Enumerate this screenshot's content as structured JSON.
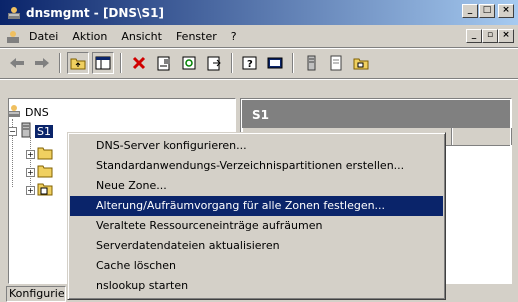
{
  "window": {
    "title": "dnsmgmt - [DNS\\S1]"
  },
  "window_buttons": [
    "_",
    "□",
    "×"
  ],
  "menu": {
    "items": [
      "Datei",
      "Aktion",
      "Ansicht",
      "Fenster",
      "?"
    ]
  },
  "mdi_buttons": [
    "_",
    "▫",
    "×"
  ],
  "tree": {
    "root": "DNS",
    "server": "S1"
  },
  "right_pane": {
    "header": "S1"
  },
  "context_menu": {
    "items": [
      "DNS-Server konfigurieren...",
      "Standardanwendungs-Verzeichnispartitionen erstellen...",
      "Neue Zone...",
      "Alterung/Aufräumvorgang für alle Zonen festlegen...",
      "Veraltete Ressourceneinträge aufräumen",
      "Serverdatendateien aktualisieren",
      "Cache löschen",
      "nslookup starten"
    ],
    "highlighted_index": 3
  },
  "status": {
    "text": "Konfigurie"
  },
  "colors": {
    "title_start": "#0a246a",
    "title_end": "#a6caf0",
    "highlight": "#0a246a",
    "face": "#d4d0c8"
  }
}
